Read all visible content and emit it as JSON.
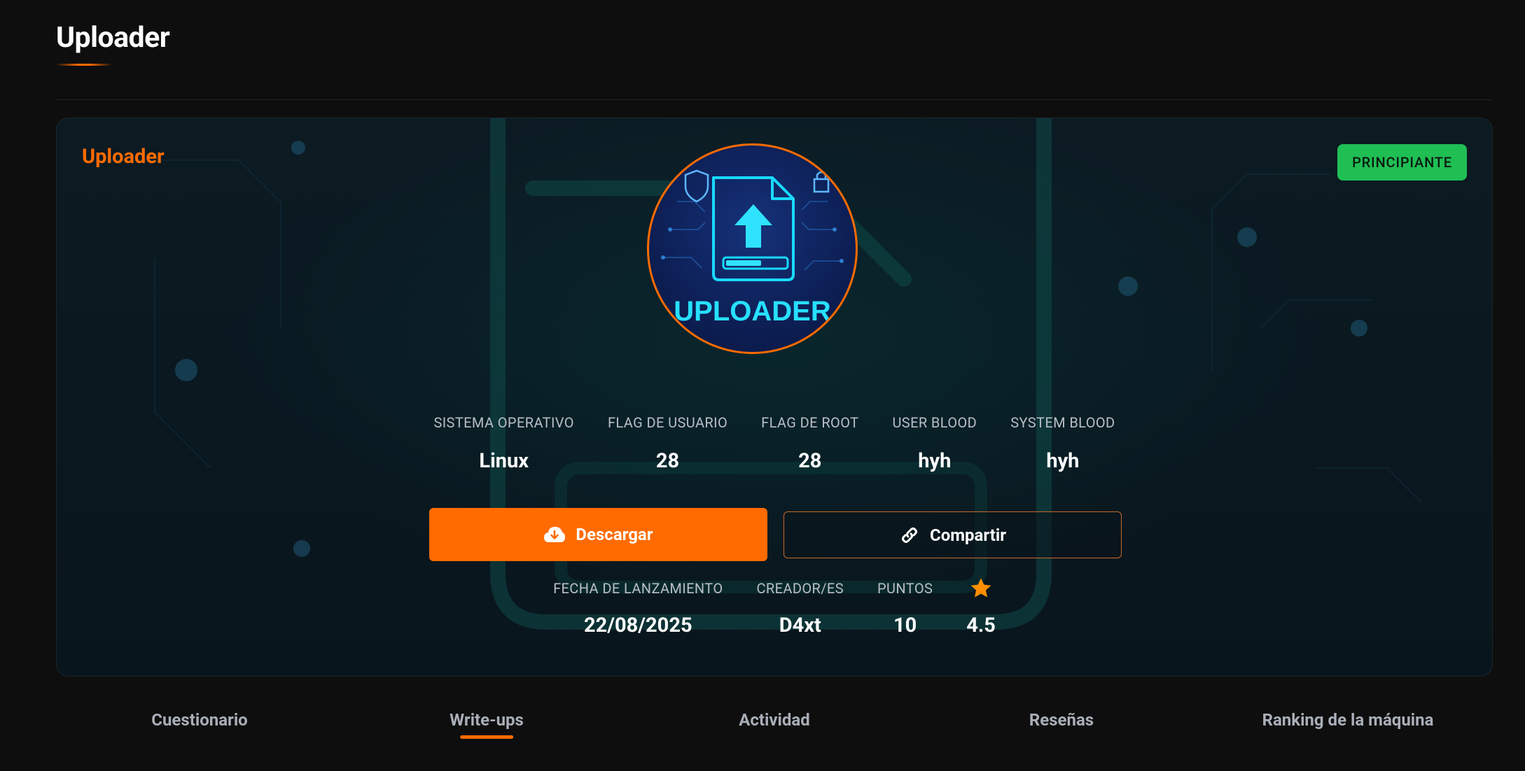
{
  "page": {
    "title": "Uploader"
  },
  "card": {
    "name": "Uploader",
    "difficulty": "PRINCIPIANTE",
    "avatar_text": "UPLOADER"
  },
  "stats": [
    {
      "label": "SISTEMA OPERATIVO",
      "value": "Linux"
    },
    {
      "label": "FLAG DE USUARIO",
      "value": "28"
    },
    {
      "label": "FLAG DE ROOT",
      "value": "28"
    },
    {
      "label": "USER BLOOD",
      "value": "hyh"
    },
    {
      "label": "SYSTEM BLOOD",
      "value": "hyh"
    }
  ],
  "actions": {
    "download_label": "Descargar",
    "share_label": "Compartir"
  },
  "meta": {
    "release_label": "FECHA DE LANZAMIENTO",
    "release_value": "22/08/2025",
    "creator_label": "CREADOR/ES",
    "creator_value": "D4xt",
    "points_label": "PUNTOS",
    "points_value": "10",
    "rating_icon": "star-icon",
    "rating_value": "4.5"
  },
  "tabs": [
    {
      "label": "Cuestionario",
      "active": false
    },
    {
      "label": "Write-ups",
      "active": true
    },
    {
      "label": "Actividad",
      "active": false
    },
    {
      "label": "Reseñas",
      "active": false
    },
    {
      "label": "Ranking de la máquina",
      "active": false
    }
  ],
  "colors": {
    "accent": "#ff6b00",
    "difficulty_badge": "#1fbf54",
    "background": "#0e0e0e"
  }
}
